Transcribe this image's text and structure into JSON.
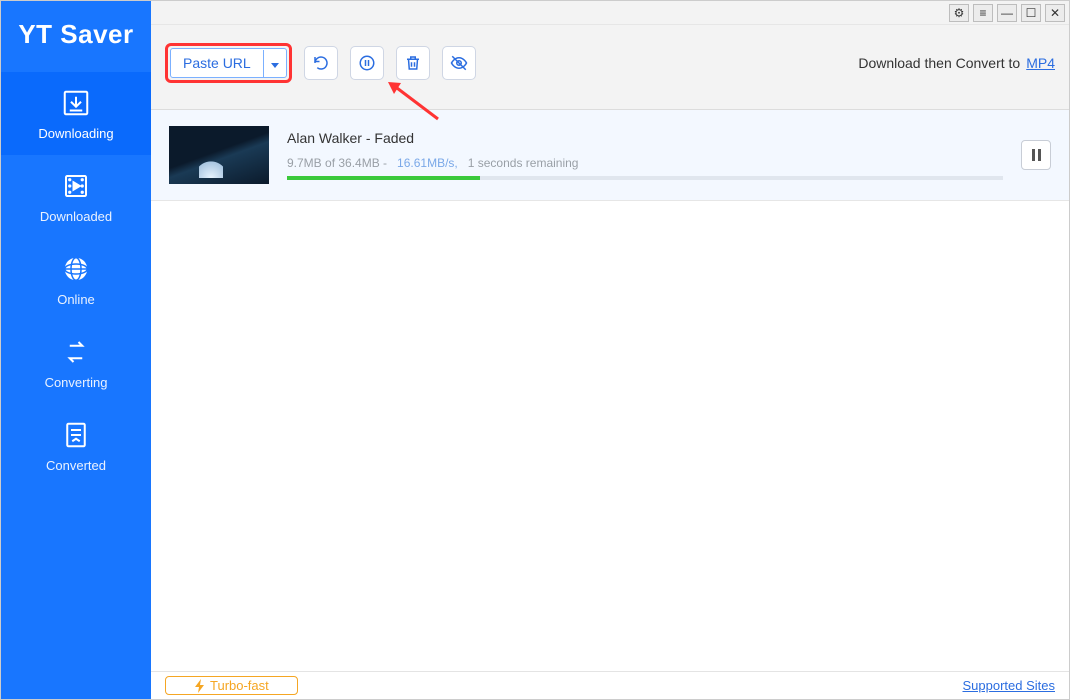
{
  "app": {
    "name": "YT Saver"
  },
  "winbar": {
    "min": "—",
    "max": "☐",
    "close": "✕",
    "settings": "⚙",
    "menu": "≡"
  },
  "sidebar": {
    "items": [
      {
        "label": "Downloading"
      },
      {
        "label": "Downloaded"
      },
      {
        "label": "Online"
      },
      {
        "label": "Converting"
      },
      {
        "label": "Converted"
      }
    ]
  },
  "toolbar": {
    "paste_label": "Paste URL",
    "convert_text": "Download then Convert to",
    "convert_target": "MP4"
  },
  "download": {
    "title": "Alan Walker - Faded",
    "progress_text": "9.7MB of 36.4MB -",
    "speed": "16.61MB/s,",
    "eta": "1 seconds remaining",
    "progress_pct": 27
  },
  "footer": {
    "turbo_label": "Turbo-fast",
    "supported_label": "Supported Sites"
  }
}
